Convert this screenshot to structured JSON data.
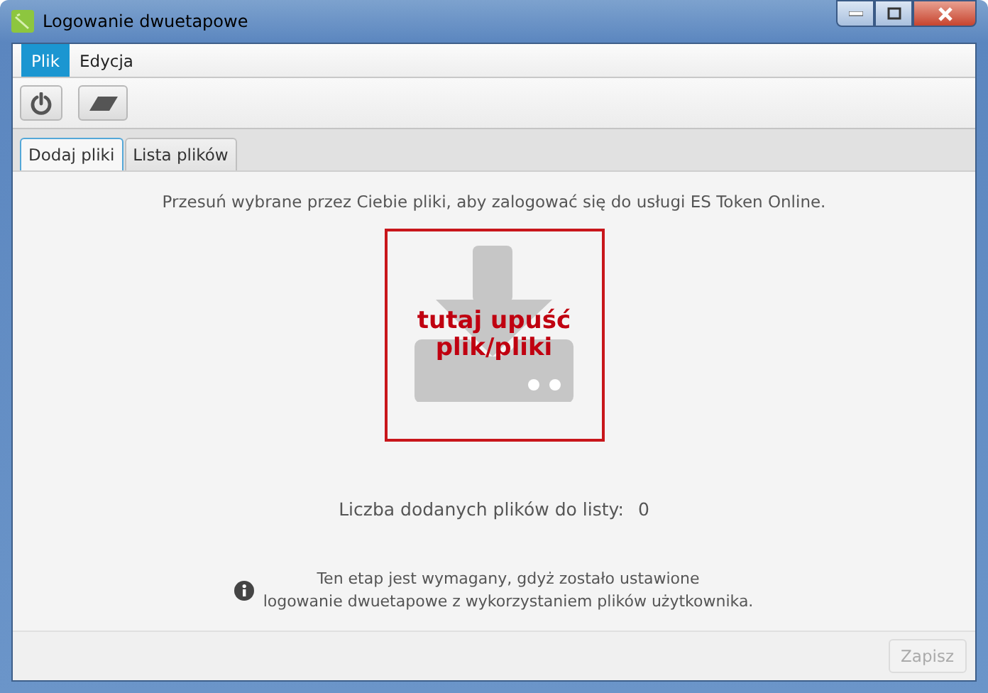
{
  "window": {
    "title": "Logowanie dwuetapowe"
  },
  "menu": [
    {
      "label": "Plik",
      "selected": true
    },
    {
      "label": "Edycja",
      "selected": false
    }
  ],
  "toolbar": [
    {
      "kind": "power"
    },
    {
      "kind": "eraser"
    }
  ],
  "tabs": [
    {
      "label": "Dodaj pliki",
      "selected": true
    },
    {
      "label": "Lista plików",
      "selected": false
    }
  ],
  "instruction": "Przesuń wybrane przez Ciebie pliki, aby zalogować się do usługi ES Token Online.",
  "drop_zone": {
    "text": "tutaj upuść plik/pliki"
  },
  "count": {
    "label": "Liczba dodanych plików do listy:",
    "value": "0"
  },
  "info_note": [
    "Ten etap jest wymagany, gdyż zostało ustawione",
    "logowanie dwuetapowe z wykorzystaniem plików użytkownika."
  ],
  "save_button": {
    "label": "Zapisz",
    "disabled": true
  }
}
